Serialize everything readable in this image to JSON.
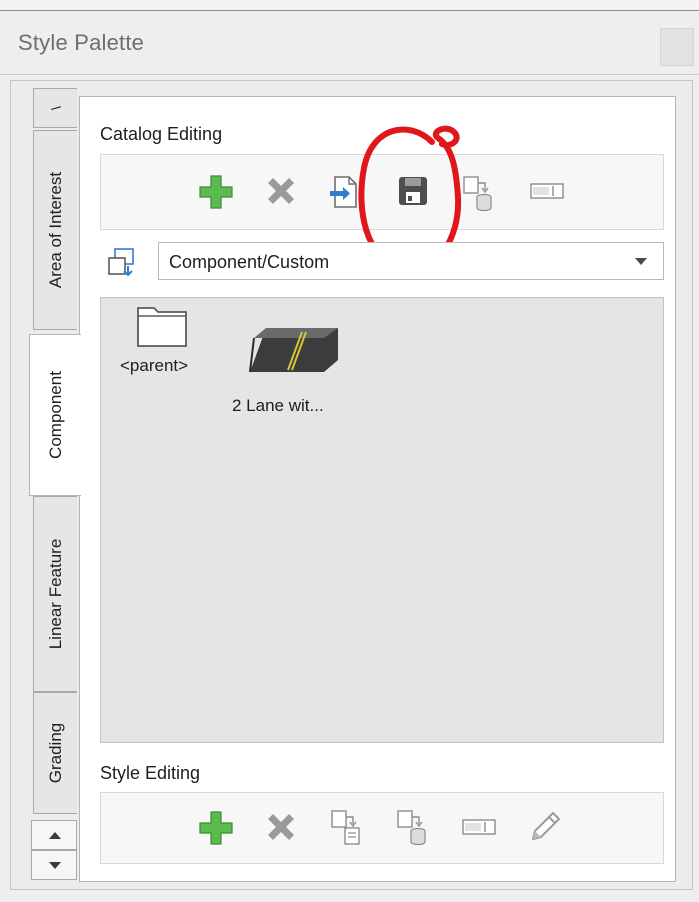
{
  "window": {
    "title": "Style Palette"
  },
  "tabs": [
    {
      "label": "Area of Interest"
    },
    {
      "label": "Component",
      "active": true
    },
    {
      "label": "Linear Feature"
    },
    {
      "label": "Grading"
    }
  ],
  "catalog_editing": {
    "label": "Catalog Editing",
    "icons": [
      "add-icon",
      "delete-icon",
      "import-icon",
      "save-icon",
      "copy-to-icon",
      "rename-icon"
    ],
    "highlighted": "save-icon",
    "highlight_color": "#e0161b"
  },
  "path_selector": {
    "value": "Component/Custom",
    "icon": "folder-browse-icon"
  },
  "browser_items": [
    {
      "label": "<parent>",
      "icon": "folder-icon"
    },
    {
      "label": "2 Lane wit...",
      "icon": "road-thumbnail-icon"
    }
  ],
  "style_editing": {
    "label": "Style Editing",
    "icons": [
      "add-icon",
      "delete-icon",
      "duplicate-icon",
      "copy-to-icon",
      "rename-icon",
      "edit-pencil-icon"
    ]
  },
  "colors": {
    "add_green": "#4caf50",
    "delete_gray": "#8f8f8f",
    "accent_blue": "#2f7fd0"
  }
}
